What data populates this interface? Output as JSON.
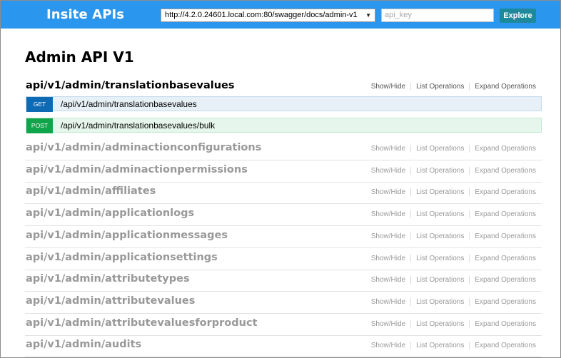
{
  "header": {
    "logo": "Insite APIs",
    "url_value": "http://4.2.0.24601.local.com:80/swagger/docs/admin-v1",
    "api_key_placeholder": "api_key",
    "explore_label": "Explore"
  },
  "main": {
    "title": "Admin API V1",
    "links": {
      "show_hide": "Show/Hide",
      "list_ops": "List Operations",
      "expand_ops": "Expand Operations"
    },
    "active_resource": "api/v1/admin/translationbasevalues",
    "operations": [
      {
        "method": "GET",
        "path": "/api/v1/admin/translationbasevalues"
      },
      {
        "method": "POST",
        "path": "/api/v1/admin/translationbasevalues/bulk"
      }
    ],
    "resources": [
      "api/v1/admin/adminactionconfigurations",
      "api/v1/admin/adminactionpermissions",
      "api/v1/admin/affiliates",
      "api/v1/admin/applicationlogs",
      "api/v1/admin/applicationmessages",
      "api/v1/admin/applicationsettings",
      "api/v1/admin/attributetypes",
      "api/v1/admin/attributevalues",
      "api/v1/admin/attributevaluesforproduct",
      "api/v1/admin/audits"
    ]
  },
  "colors": {
    "header_bg": "#2b96ee",
    "get": "#0f6ab4",
    "post": "#10a54a",
    "explore": "#1d8a9b"
  }
}
